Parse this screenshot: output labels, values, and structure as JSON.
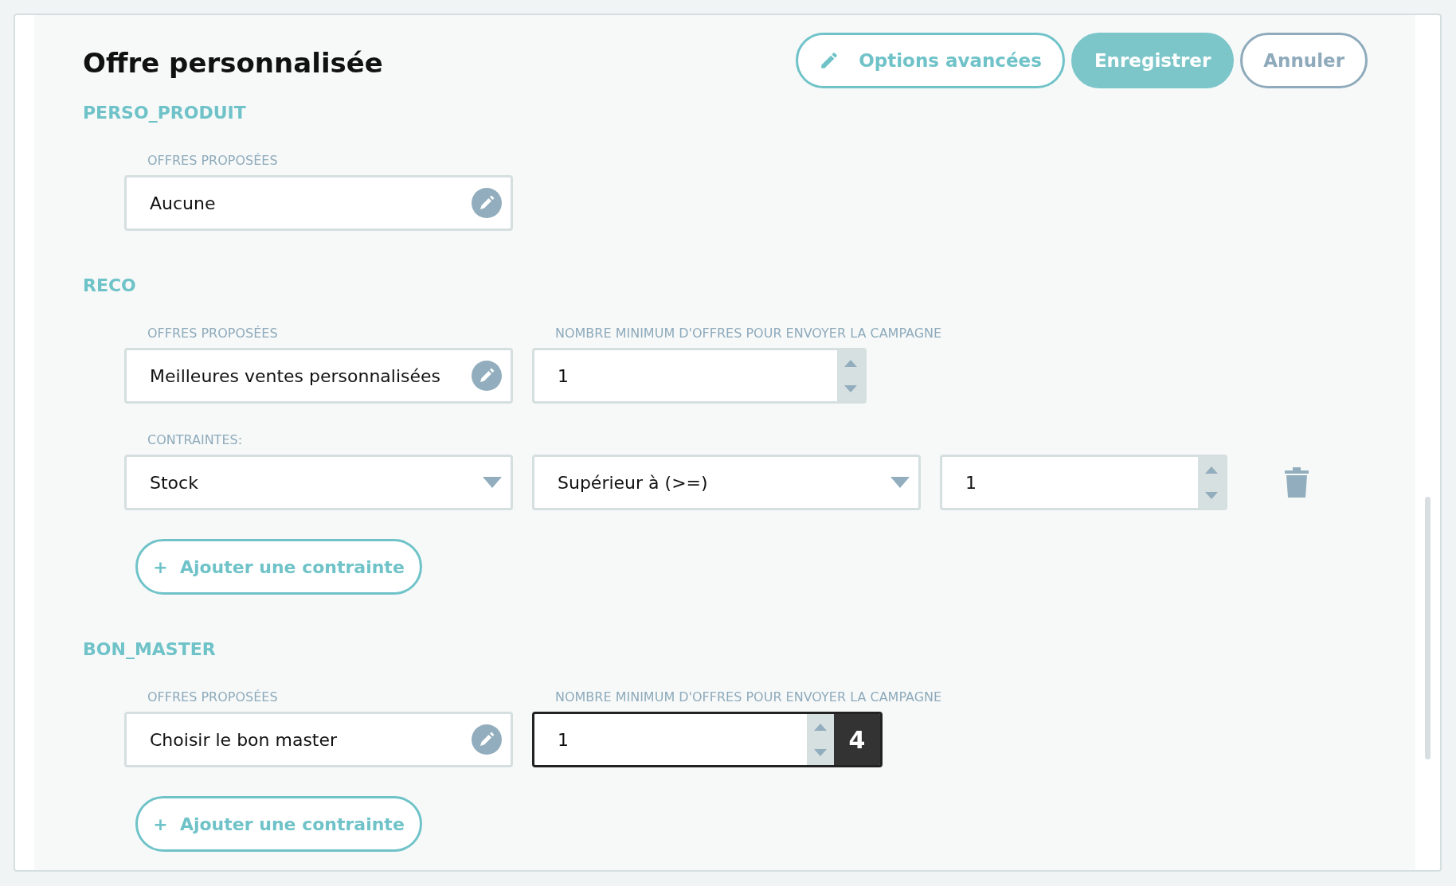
{
  "title": "Offre personnalisée",
  "actions": [
    {
      "kind": "outline",
      "label": "Options avancées"
    },
    {
      "kind": "primary",
      "label": "Enregistrer"
    },
    {
      "kind": "muted",
      "label": "Annuler"
    }
  ],
  "sections": [
    {
      "heading": "PERSO_PRODUIT",
      "offers": {
        "label": "OFFRES PROPOSÉES",
        "value": "Aucune"
      }
    },
    {
      "heading": "RECO",
      "offers": {
        "label": "OFFRES PROPOSÉES",
        "value": "Meilleures ventes personnalisées"
      },
      "minimum": {
        "label": "NOMBRE MINIMUM D'OFFRES POUR ENVOYER LA CAMPAGNE",
        "value": "1",
        "focused": false
      },
      "constraints_label": "CONTRAINTES:",
      "constraints": [
        {
          "field": "Stock",
          "operator": "Supérieur à (>=)",
          "value": "1"
        }
      ],
      "add_button": "+  Ajouter une contrainte"
    },
    {
      "heading": "BON_MASTER",
      "offers": {
        "label": "OFFRES PROPOSÉES",
        "value": "Choisir le bon master"
      },
      "minimum": {
        "label": "NOMBRE MINIMUM D'OFFRES POUR ENVOYER LA CAMPAGNE",
        "value": "1",
        "focused": true,
        "badge": "4"
      },
      "add_button": "+  Ajouter une contrainte"
    }
  ]
}
